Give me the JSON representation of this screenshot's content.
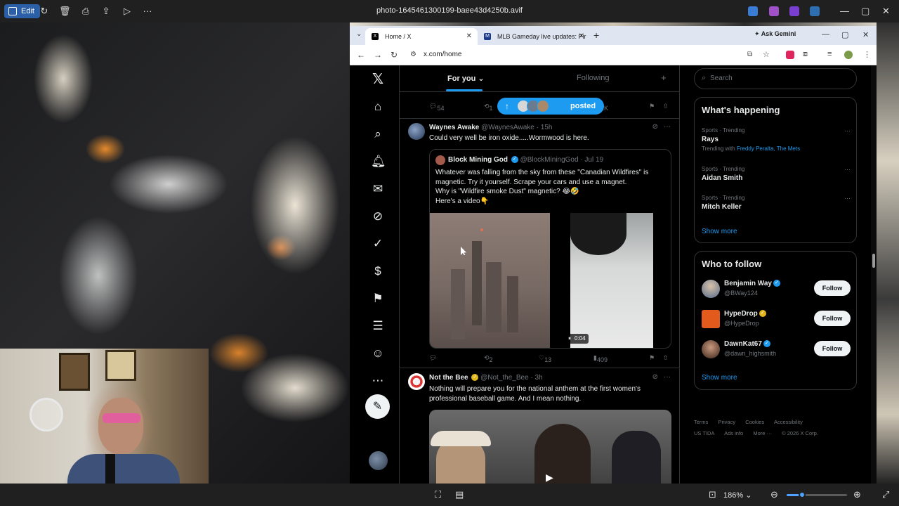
{
  "photo_viewer": {
    "title": "photo-1645461300199-baee43d4250b.avif",
    "edit_label": "Edit",
    "zoom_label": "186%",
    "zoom_fraction": 0.25
  },
  "browser": {
    "tabs": [
      {
        "label": "Home / X",
        "active": true
      },
      {
        "label": "MLB Gameday live updates: Pir",
        "active": false
      }
    ],
    "gemini_label": "Ask Gemini",
    "url": "x.com/home"
  },
  "x": {
    "tabs": {
      "for_you": "For you",
      "following": "Following"
    },
    "posted_pill": "posted",
    "top_actions": {
      "replies": "54",
      "reposts": "1",
      "views": "81K"
    },
    "posts": [
      {
        "name": "Waynes Awake",
        "handle": "@WaynesAwake",
        "time": "· 15h",
        "text": "Could very well be iron oxide.....Wormwood is here.",
        "quote": {
          "name": "Block Mining God",
          "handle": "@BlockMiningGod",
          "time": "· Jul 19",
          "lines": [
            "Whatever was falling from the sky from these \"Canadian Wildfires\" is",
            "magnetic. Try it yourself. Scrape your cars and use a magnet.",
            "Why is \"Wildfire smoke Dust\"  magnetic? 😂🤣",
            "Here's a video👇"
          ],
          "video_time": "0:04"
        },
        "actions": {
          "replies": "",
          "reposts": "2",
          "likes": "13",
          "views": "409"
        }
      },
      {
        "name": "Not the Bee",
        "handle": "@Not_the_Bee",
        "time": "· 3h",
        "lines": [
          "Nothing will prepare you for the national anthem at the first women's",
          "professional baseball game. And I mean nothing."
        ]
      }
    ],
    "sidebar": {
      "search_placeholder": "Search",
      "happening_title": "What's happening",
      "trends": [
        {
          "context": "Sports · Trending",
          "name": "Rays",
          "with_prefix": "Trending with",
          "with": "Freddy Peralta, The Mets"
        },
        {
          "context": "Sports · Trending",
          "name": "Aidan Smith"
        },
        {
          "context": "Sports · Trending",
          "name": "Mitch Keller"
        }
      ],
      "show_more": "Show more",
      "who_title": "Who to follow",
      "follow_label": "Follow",
      "who": [
        {
          "name": "Benjamin Way",
          "handle": "@BWay124",
          "badge": "blue"
        },
        {
          "name": "HypeDrop",
          "handle": "@HypeDrop",
          "badge": "gold"
        },
        {
          "name": "DawnKat67",
          "handle": "@dawn_highsmith",
          "badge": "blue"
        }
      ],
      "footer_line1": [
        "Terms",
        "Privacy",
        "Cookies",
        "Accessibility"
      ],
      "footer_line2": [
        "US TIDA",
        "Ads info",
        "More ···",
        "© 2026 X Corp."
      ]
    }
  },
  "icons": {
    "nav": [
      "x-logo-icon",
      "home-icon",
      "search-icon",
      "bell-icon",
      "messages-icon",
      "grok-icon",
      "verified-icon",
      "money-icon",
      "bookmark-icon",
      "lists-icon",
      "profile-icon",
      "more-icon",
      "compose-icon"
    ]
  }
}
